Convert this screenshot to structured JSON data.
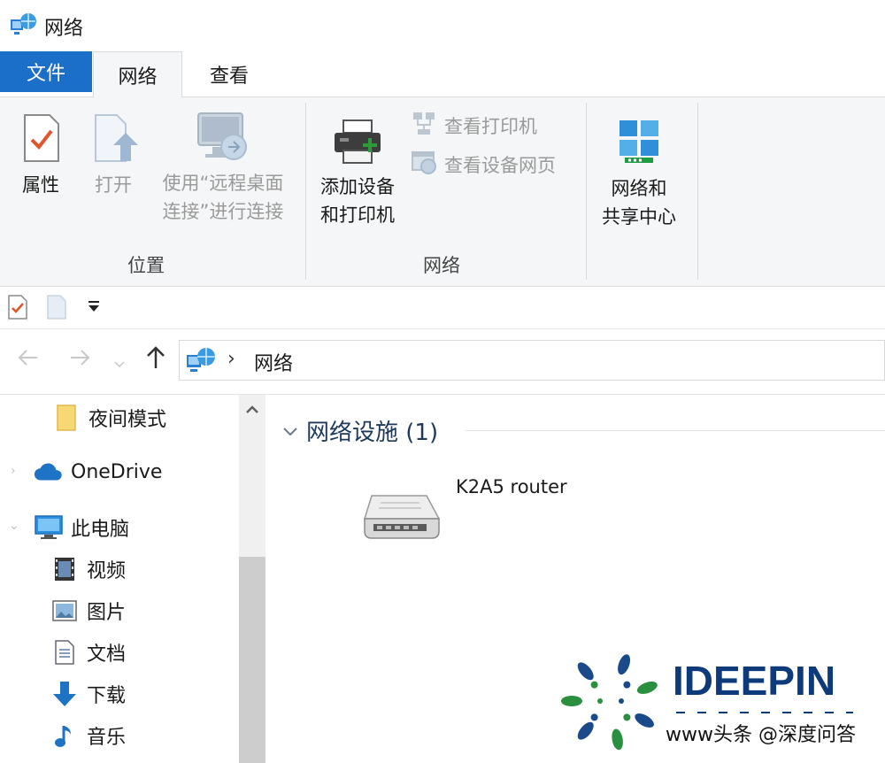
{
  "window": {
    "title": "网络"
  },
  "ribbon_tabs": {
    "file": "文件",
    "network": "网络",
    "view": "查看"
  },
  "ribbon": {
    "location_group": {
      "label": "位置",
      "properties": "属性",
      "open": "打开",
      "remote_line1": "使用“远程桌面",
      "remote_line2": "连接”进行连接"
    },
    "network_group": {
      "label": "网络",
      "add_device_line1": "添加设备",
      "add_device_line2": "和打印机",
      "view_printers": "查看打印机",
      "view_device_webpage": "查看设备网页"
    },
    "sharing_group": {
      "line1": "网络和",
      "line2": "共享中心"
    }
  },
  "address_bar": {
    "separator": "›",
    "crumb": "网络"
  },
  "nav_pane": {
    "items": [
      {
        "label": "夜间模式"
      },
      {
        "label": "OneDrive"
      },
      {
        "label": "此电脑"
      },
      {
        "label": "视频"
      },
      {
        "label": "图片"
      },
      {
        "label": "文档"
      },
      {
        "label": "下载"
      },
      {
        "label": "音乐"
      }
    ]
  },
  "content": {
    "section_title": "网络设施 (1)",
    "devices": [
      {
        "name": "K2A5 router"
      }
    ]
  },
  "watermark": {
    "brand": "IDEEPIN",
    "caption": "www头条 @深度问答"
  },
  "colors": {
    "accent": "#1c6fc8",
    "ribbon_bg": "#f5f6f7",
    "section_header": "#1e395b",
    "brand": "#0d3a7a"
  }
}
